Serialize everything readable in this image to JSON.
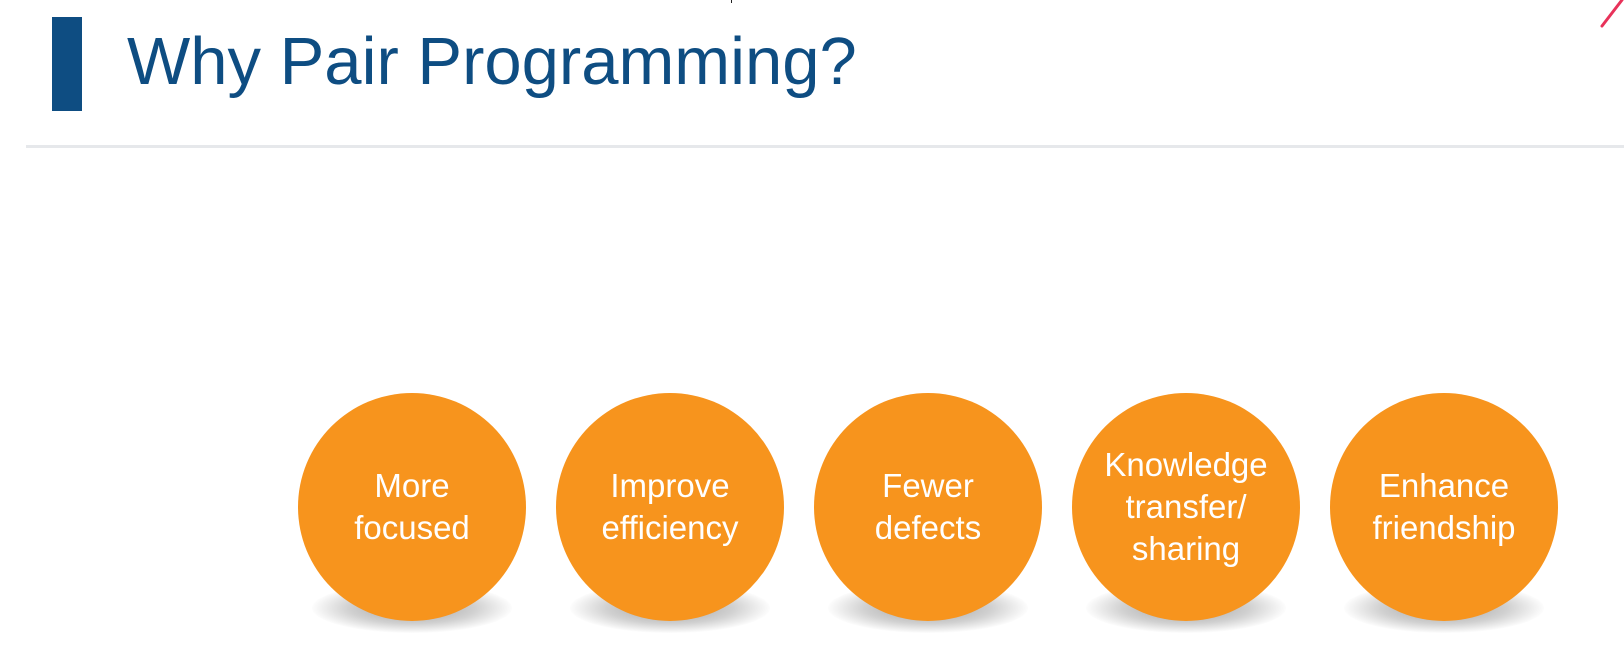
{
  "slide": {
    "title": "Why Pair Programming?",
    "colors": {
      "title_text": "#0e4d82",
      "title_bar": "#0e4d82",
      "circle_fill": "#f7941d",
      "circle_text": "#ffffff",
      "corner_mark": "#e8325a"
    },
    "benefits": [
      {
        "label": "More\nfocused"
      },
      {
        "label": "Improve\nefficiency"
      },
      {
        "label": "Fewer\ndefects"
      },
      {
        "label": "Knowledge\ntransfer/\nsharing"
      },
      {
        "label": "Enhance\nfriendship"
      }
    ]
  }
}
